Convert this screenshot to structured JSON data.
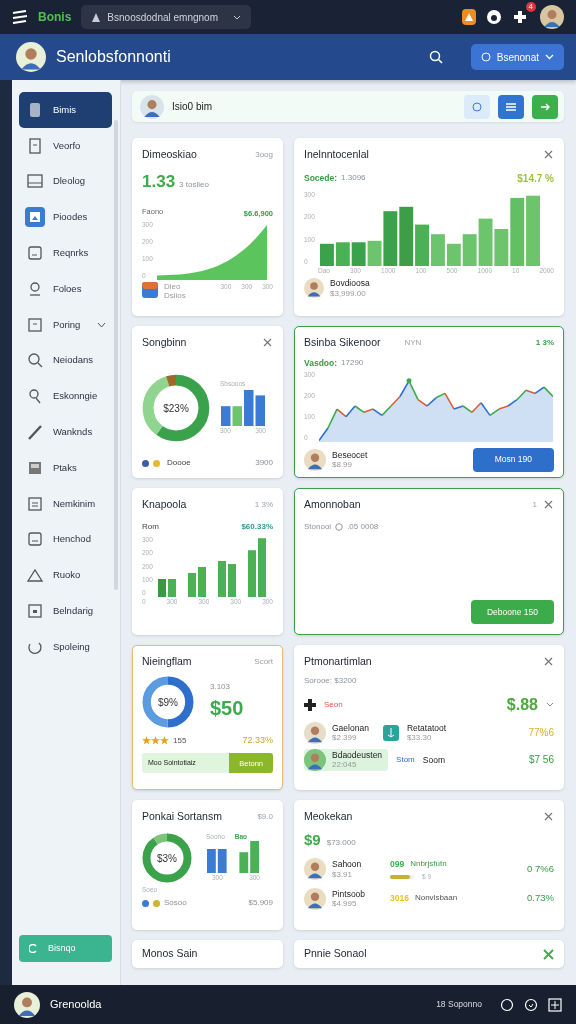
{
  "top_bar": {
    "brand": "Bonis",
    "search": {
      "value": "Bsnoosdodnal emngnom"
    },
    "notifications": "4"
  },
  "header": {
    "title": "Senlobsfonnonti",
    "account_button": "Bsenonat"
  },
  "sidebar": {
    "items": [
      {
        "label": "Bimis",
        "selected": true,
        "highlighted": false,
        "kind": "link"
      },
      {
        "label": "Veorfo",
        "selected": false,
        "highlighted": false,
        "kind": "link"
      },
      {
        "label": "Dleolog",
        "selected": false,
        "highlighted": false,
        "kind": "link"
      },
      {
        "label": "Pioodes",
        "selected": false,
        "highlighted": true,
        "kind": "link"
      },
      {
        "label": "Reqnrks",
        "selected": false,
        "highlighted": false,
        "kind": "link"
      },
      {
        "label": "Foloes",
        "selected": false,
        "highlighted": false,
        "kind": "link"
      },
      {
        "label": "Poring",
        "selected": false,
        "highlighted": false,
        "kind": "group",
        "expanded": false
      },
      {
        "label": "Neiodans",
        "selected": false,
        "highlighted": false,
        "kind": "link"
      },
      {
        "label": "Eskonngie",
        "selected": false,
        "highlighted": false,
        "kind": "link"
      },
      {
        "label": "Wanknds",
        "selected": false,
        "highlighted": false,
        "kind": "link"
      },
      {
        "label": "Ptaks",
        "selected": false,
        "highlighted": false,
        "kind": "link"
      },
      {
        "label": "Nemkinim",
        "selected": false,
        "highlighted": false,
        "kind": "link"
      },
      {
        "label": "Henchod",
        "selected": false,
        "highlighted": false,
        "kind": "link"
      },
      {
        "label": "Ruoko",
        "selected": false,
        "highlighted": false,
        "kind": "link"
      },
      {
        "label": "Belndarig",
        "selected": false,
        "highlighted": false,
        "kind": "link"
      },
      {
        "label": "Spoleing",
        "selected": false,
        "highlighted": false,
        "kind": "link"
      }
    ],
    "footer_button": "Bisnqo"
  },
  "welcome": {
    "text": "Isio0 bim"
  },
  "cards": [
    {
      "kind": "area",
      "title": "Dimeoskiao",
      "meta": "3oog",
      "value": "1.33",
      "value_note": "3 toslieo",
      "chart_label": "Faono",
      "chart_value": "$6.6,900",
      "y_ticks": [
        "300",
        "200",
        "100",
        "0"
      ],
      "x_ticks": [
        "300",
        "300",
        "300"
      ],
      "footer_title": "Dleo",
      "footer": "Dsiios"
    },
    {
      "kind": "bars",
      "title": "Inelnntocenlal",
      "closable": true,
      "stat_label": "Socede:",
      "stat_value": "1.3096",
      "change": "$14.7 %",
      "y_ticks": [
        "300",
        "200",
        "100",
        "0"
      ],
      "x_ticks": [
        "Dao",
        "300",
        "1000",
        "100",
        "500",
        "1000",
        "10",
        "2000"
      ],
      "person": "Bovdioosa",
      "amount": "$3,999.00"
    },
    {
      "kind": "donut_bars",
      "title": "Songbinn",
      "closable": true,
      "donut_label": "$23%",
      "bars_label": "Sbsooos",
      "x_ticks": [
        "300",
        "300"
      ],
      "legend": "Doooe",
      "total": "3900"
    },
    {
      "kind": "line",
      "title": "Bsinba Sikenoor",
      "meta": "NYN",
      "change": "1 3%",
      "stat_label": "Vasdoo:",
      "stat_value": "17290",
      "y_ticks": [
        "300",
        "200",
        "100",
        "0"
      ],
      "person": "Beseocet",
      "amount": "$8.99",
      "button": "Mosn 190",
      "color": "#3f9e4a"
    },
    {
      "kind": "bars_compact",
      "title": "Knapoola",
      "meta": "1 3%",
      "stat_label": "Rom",
      "change": "$60.33%",
      "y_ticks": [
        "300",
        "200",
        "200",
        "100",
        "0"
      ],
      "x_ticks": [
        "0",
        "300",
        "300",
        "300",
        "300"
      ]
    },
    {
      "kind": "note",
      "title": "Amonnoban",
      "meta": "1",
      "closable": true,
      "status_label": "Stonooi",
      "status_value": ".05 0008",
      "button": "Deboone 150",
      "color": "#3f9e4a"
    },
    {
      "kind": "donut_stat",
      "title": "Nieingflam",
      "meta": "Scort",
      "donut_label": "$9%",
      "stat_label": "3.103",
      "value": "$50",
      "stars": 3,
      "rating_count": "155",
      "change": "72.33%",
      "progress_label": "Moo Sointotiaiz",
      "progress_button": "Betonn",
      "color": "#e0c070"
    },
    {
      "kind": "list",
      "title": "Ptmonartimlan",
      "closable": true,
      "subtitle": "Sorooe: $3200",
      "tag": "Seon",
      "value": "$.88",
      "rows": [
        {
          "name": "Gaelonan",
          "amount": "$2.399",
          "second_name": "Retatatoot",
          "second_amount": "$33.30",
          "change": "77%6",
          "selected": false
        },
        {
          "name": "Bdaodeusten",
          "amount": "22:045",
          "tag": "Stom",
          "second_name": "Soom",
          "change": "$7 56",
          "selected": true
        }
      ]
    },
    {
      "kind": "donut_legend",
      "title": "Ponkai Sortansm",
      "meta": "$9.0",
      "donut_label": "$3%",
      "bar_labels": [
        "Soono",
        "Bao"
      ],
      "x_ticks": [
        "300",
        "300"
      ],
      "legend_title": "Soeo",
      "legend": "Sosoo",
      "total": "$5.909"
    },
    {
      "kind": "people",
      "title": "Meokekan",
      "closable": true,
      "value": "$9",
      "value_note": "$73.000",
      "rows": [
        {
          "name": "Sahoon",
          "amount": "$3.91",
          "code": "099",
          "color": "#3cab4a",
          "label": "Nnbrjsfutn",
          "level": 0.85,
          "level_note": "$ 9",
          "change": "0 7%6"
        },
        {
          "name": "Pintsoob",
          "amount": "$4.995",
          "code": "3016",
          "color": "#e6c229",
          "label": "Nonvlsbaan",
          "change": "0.73%"
        }
      ]
    },
    {
      "kind": "title_only",
      "title": "Monos Sain",
      "action": false
    },
    {
      "kind": "title_only",
      "title": "Pnnie Sonaol",
      "action": true
    }
  ],
  "bottom_bar": {
    "user": "Grenoolda",
    "status": "18 Soponno"
  }
}
